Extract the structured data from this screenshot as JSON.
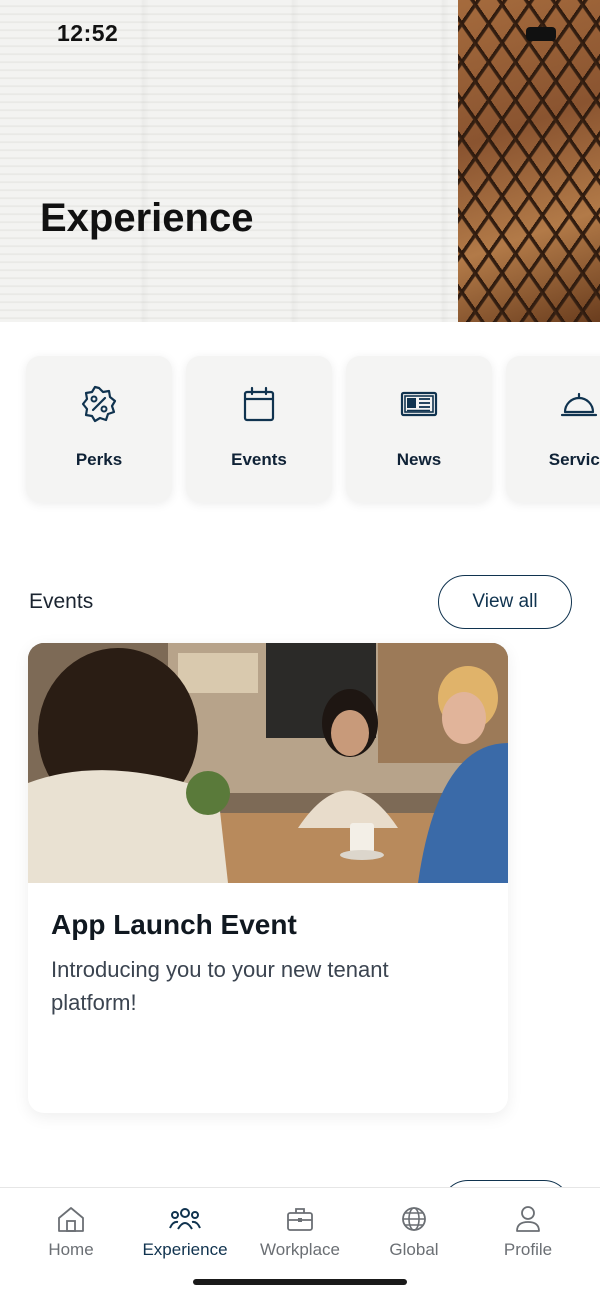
{
  "status_bar": {
    "time": "12:52"
  },
  "hero": {
    "title": "Experience"
  },
  "quick_links": [
    {
      "label": "Perks",
      "icon": "percent-badge-icon"
    },
    {
      "label": "Events",
      "icon": "calendar-icon"
    },
    {
      "label": "News",
      "icon": "newspaper-icon"
    },
    {
      "label": "Service",
      "icon": "service-bell-icon"
    }
  ],
  "events_section": {
    "title": "Events",
    "view_all_label": "View all",
    "card": {
      "title": "App Launch Event",
      "description": "Introducing you to your new tenant platform!"
    }
  },
  "tab_bar": {
    "tabs": [
      {
        "label": "Home",
        "icon": "home-icon"
      },
      {
        "label": "Experience",
        "icon": "people-icon",
        "active": true
      },
      {
        "label": "Workplace",
        "icon": "briefcase-icon"
      },
      {
        "label": "Global",
        "icon": "globe-icon"
      },
      {
        "label": "Profile",
        "icon": "person-icon"
      }
    ]
  },
  "colors": {
    "accent": "#10334f",
    "tab_inactive": "#6b6f74"
  }
}
